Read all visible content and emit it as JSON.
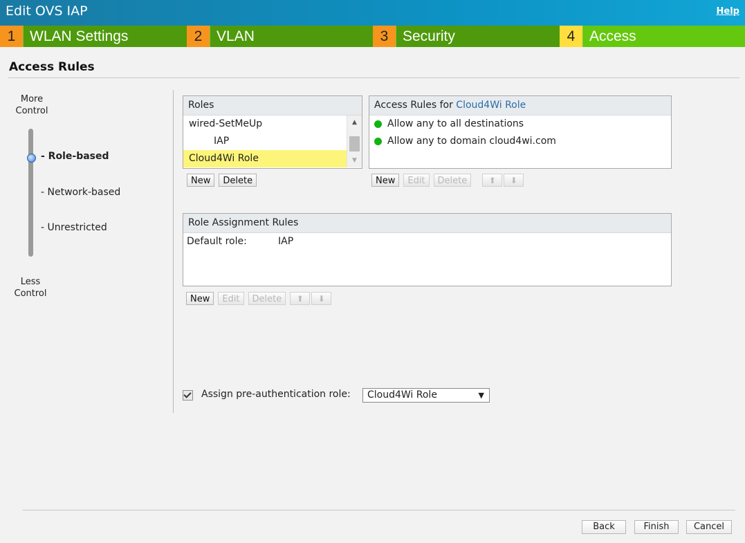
{
  "window": {
    "title": "Edit OVS IAP",
    "help": "Help"
  },
  "steps": [
    {
      "num": "1",
      "label": "WLAN Settings"
    },
    {
      "num": "2",
      "label": "VLAN"
    },
    {
      "num": "3",
      "label": "Security"
    },
    {
      "num": "4",
      "label": "Access"
    }
  ],
  "section": {
    "title": "Access Rules"
  },
  "slider": {
    "top_label": "More Control",
    "bottom_label": "Less Control",
    "options": [
      "- Role-based",
      "- Network-based",
      "- Unrestricted"
    ],
    "selected": "- Role-based"
  },
  "roles": {
    "header": "Roles",
    "items": [
      "wired-SetMeUp",
      "IAP",
      "Cloud4Wi Role"
    ],
    "selected": "Cloud4Wi Role",
    "new_btn": "New",
    "delete_btn": "Delete"
  },
  "access_rules": {
    "header_prefix": "Access Rules for ",
    "role": "Cloud4Wi Role",
    "rules": [
      "Allow any to all destinations",
      "Allow any to domain cloud4wi.com"
    ],
    "rule_status_color": "#11b312",
    "new_btn": "New",
    "edit_btn": "Edit",
    "delete_btn": "Delete"
  },
  "assignment": {
    "header": "Role Assignment Rules",
    "default_label": "Default role:",
    "default_value": "IAP",
    "new_btn": "New",
    "edit_btn": "Edit",
    "delete_btn": "Delete"
  },
  "preauth": {
    "checked": true,
    "label": "Assign pre-authentication role:",
    "value": "Cloud4Wi Role"
  },
  "footer": {
    "back": "Back",
    "finish": "Finish",
    "cancel": "Cancel"
  },
  "colors": {
    "step_number": "#f7941d",
    "step_active_number": "#ffde3d",
    "step_label": "#4e9a0c",
    "step_active_label": "#64c80f",
    "selected_role": "#fdf57a"
  }
}
